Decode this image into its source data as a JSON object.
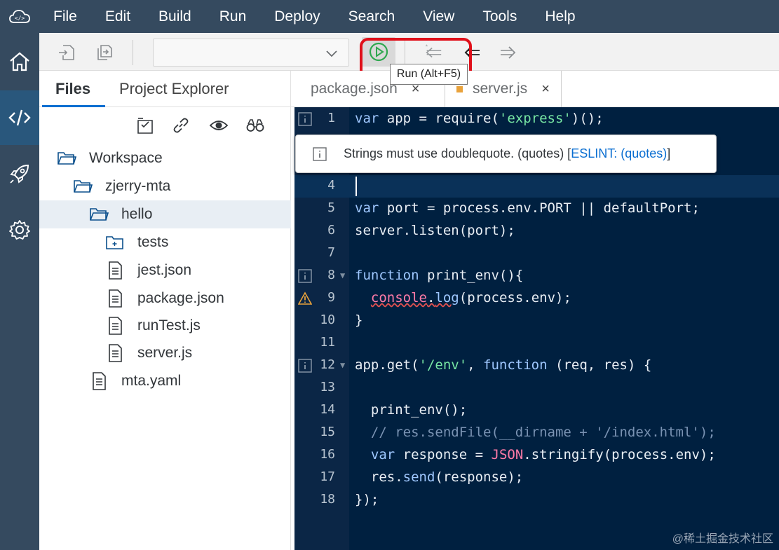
{
  "menubar": {
    "logo": "cloud-code-icon",
    "items": [
      "File",
      "Edit",
      "Build",
      "Run",
      "Deploy",
      "Search",
      "View",
      "Tools",
      "Help"
    ]
  },
  "activitybar": {
    "items": [
      "home-icon",
      "code-icon",
      "rocket-icon",
      "gear-icon"
    ],
    "active_index": 1
  },
  "toolbar": {
    "select_value": "",
    "run_tooltip": "Run (Alt+F5)"
  },
  "sidebar": {
    "tabs": [
      "Files",
      "Project Explorer"
    ],
    "active_tab": "Files",
    "tree": [
      {
        "label": "Workspace",
        "type": "folder-open"
      },
      {
        "label": "zjerry-mta",
        "type": "folder-open"
      },
      {
        "label": "hello",
        "type": "folder-open",
        "selected": true
      },
      {
        "label": "tests",
        "type": "test-folder"
      },
      {
        "label": "jest.json",
        "type": "file"
      },
      {
        "label": "package.json",
        "type": "file"
      },
      {
        "label": "runTest.js",
        "type": "file"
      },
      {
        "label": "server.js",
        "type": "file"
      },
      {
        "label": "mta.yaml",
        "type": "file"
      }
    ]
  },
  "editor_tabs": [
    {
      "label": "package.json",
      "close": "×"
    },
    {
      "label": "server.js",
      "close": "×",
      "active": true
    }
  ],
  "lint_popup": {
    "message": "Strings must use doublequote. (quotes) [",
    "link": "ESLINT: (quotes)",
    "end": "]"
  },
  "code": {
    "line_numbers": [
      "1",
      "4",
      "5",
      "6",
      "7",
      "8",
      "9",
      "10",
      "11",
      "12",
      "13",
      "14",
      "15",
      "16",
      "17",
      "18"
    ]
  },
  "watermark": "@稀土掘金技术社区",
  "colors": {
    "menubar_bg": "#354a5f",
    "editor_bg": "#002040",
    "accent": "#0a6ed1",
    "highlight_red": "#e0101a"
  }
}
